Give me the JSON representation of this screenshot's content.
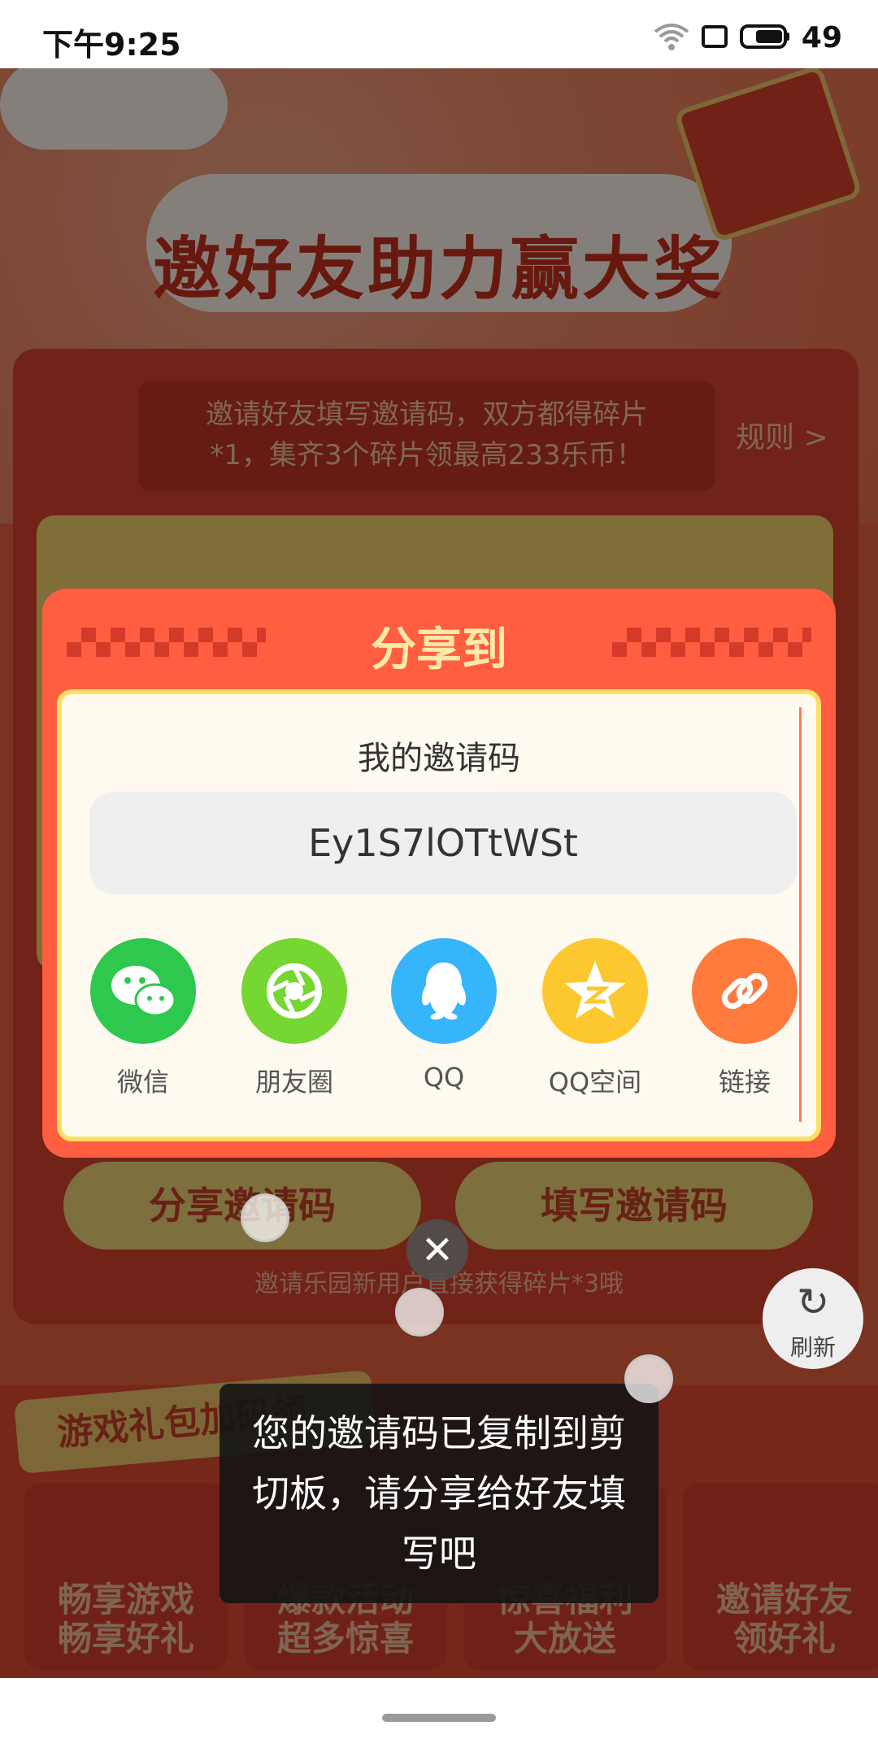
{
  "status_bar": {
    "time": "下午9:25",
    "battery": "49"
  },
  "page": {
    "title": "邀好友助力赢大奖",
    "tip_line1": "邀请好友填写邀请码，双方都得碎片",
    "tip_line2": "*1，集齐3个碎片领最高233乐币！",
    "rules_link": "规则 >",
    "share_code_button": "分享邀请码",
    "fill_code_button": "填写邀请码",
    "new_user_tip": "邀请乐园新用户直接获得碎片*3哦",
    "gift_tag": "游戏礼包加码领",
    "feature_cards": [
      {
        "line1": "畅享游戏",
        "line2": "畅享好礼"
      },
      {
        "line1": "爆款活动",
        "line2": "超多惊喜"
      },
      {
        "line1": "惊喜福利",
        "line2": "大放送"
      },
      {
        "line1": "邀请好友",
        "line2": "领好礼"
      }
    ],
    "refresh_label": "刷新"
  },
  "dialog": {
    "title": "分享到",
    "code_label": "我的邀请码",
    "invite_code": "Ey1S7lOTtWSt",
    "share_targets": [
      {
        "label": "微信",
        "icon": "wechat-icon",
        "color": "#2dc84d"
      },
      {
        "label": "朋友圈",
        "icon": "moments-icon",
        "color": "#76d632"
      },
      {
        "label": "QQ",
        "icon": "qq-icon",
        "color": "#37b5fa"
      },
      {
        "label": "QQ空间",
        "icon": "qzone-icon",
        "color": "#fdc72f"
      },
      {
        "label": "链接",
        "icon": "link-icon",
        "color": "#ff7a3d"
      }
    ]
  },
  "toast": {
    "message": "您的邀请码已复制到剪切板，请分享给好友填写吧"
  }
}
